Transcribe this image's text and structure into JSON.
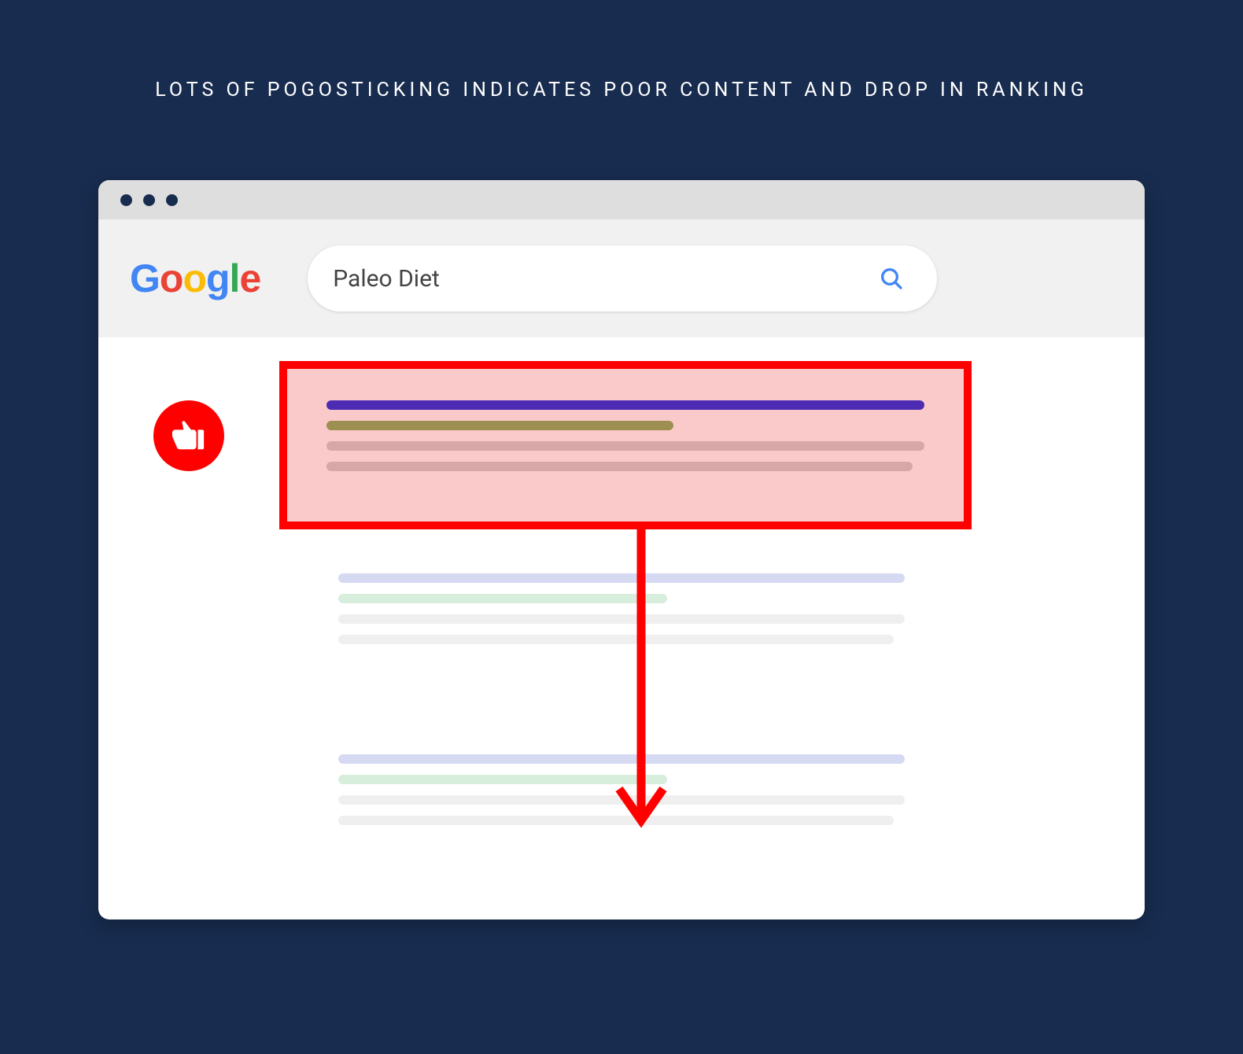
{
  "title": "LOTS OF POGOSTICKING INDICATES POOR CONTENT AND DROP IN RANKING",
  "logo": {
    "g1": "G",
    "g2": "o",
    "g3": "o",
    "g4": "g",
    "g5": "l",
    "g6": "e"
  },
  "search": {
    "query": "Paleo Diet"
  },
  "colors": {
    "accent_red": "#ff0000",
    "highlight_bg": "#fac9c9"
  }
}
